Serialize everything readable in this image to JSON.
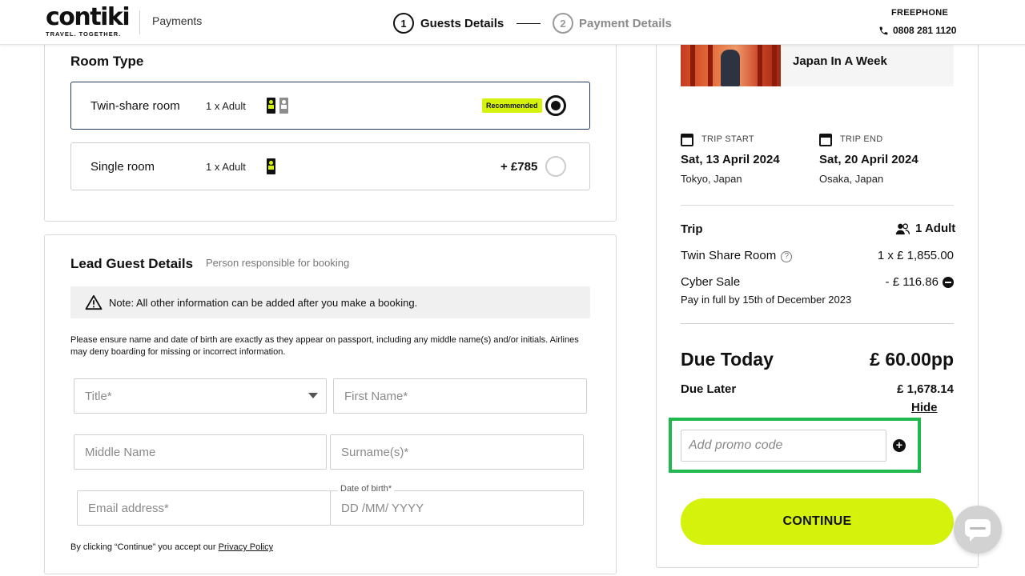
{
  "header": {
    "logo_word": "contiki",
    "logo_tagline": "TRAVEL. TOGETHER.",
    "section": "Payments",
    "steps": [
      {
        "number": "1",
        "label": "Guests Details",
        "active": true
      },
      {
        "number": "2",
        "label": "Payment Details",
        "active": false
      }
    ],
    "freephone_label": "FREEPHONE",
    "phone_number": "0808 281 1120"
  },
  "room_type": {
    "title": "Room Type",
    "options": [
      {
        "name": "Twin-share room",
        "occupancy": "1 x Adult",
        "badge": "Recommended",
        "price": "",
        "selected": true
      },
      {
        "name": "Single room",
        "occupancy": "1 x Adult",
        "badge": "",
        "price": "+ £785",
        "selected": false
      }
    ]
  },
  "lead_guest": {
    "title": "Lead Guest Details",
    "subtitle": "Person responsible for booking",
    "note": "Note: All other information can be added after you make a booking.",
    "passport_notice": "Please ensure name and date of birth are exactly as they appear on passport, including any middle name(s) and/or initials. Airlines may deny boarding for missing or incorrect information.",
    "fields": {
      "title_placeholder": "Title*",
      "first_name_placeholder": "First Name*",
      "middle_name_placeholder": "Middle Name",
      "surname_placeholder": "Surname(s)*",
      "email_placeholder": "Email address*",
      "dob_label": "Date of birth*",
      "dob_placeholder": "DD /MM/ YYYY"
    },
    "accept_text": "By clicking “Continue” you accept our",
    "privacy_link": "Privacy Policy"
  },
  "summary": {
    "trip_name": "Japan In A Week",
    "trip_start_label": "TRIP START",
    "trip_start_date": "Sat, 13 April 2024",
    "trip_start_city": "Tokyo, Japan",
    "trip_end_label": "TRIP END",
    "trip_end_date": "Sat, 20 April 2024",
    "trip_end_city": "Osaka, Japan",
    "trip_label": "Trip",
    "travellers": "1 Adult",
    "room_line_label": "Twin Share Room",
    "room_line_value": "1 x £ 1,855.00",
    "sale_label": "Cyber Sale",
    "sale_value": "- £ 116.86",
    "pay_note": "Pay in full by 15th of December 2023",
    "due_today_label": "Due Today",
    "due_today_value": "£ 60.00pp",
    "due_later_label": "Due Later",
    "due_later_value": "£ 1,678.14",
    "hide_link": "Hide",
    "promo_placeholder": "Add promo code",
    "continue_label": "CONTINUE"
  },
  "colors": {
    "accent_lime": "#d4f20c",
    "highlight_green": "#1eb84f",
    "selected_border": "#1b3a5c"
  },
  "icons": [
    "phone-icon",
    "person-icon",
    "calendar-icon",
    "users-icon",
    "help-icon",
    "minus-circle-icon",
    "plus-circle-icon",
    "warning-icon",
    "chevron-down-icon",
    "chat-icon"
  ]
}
